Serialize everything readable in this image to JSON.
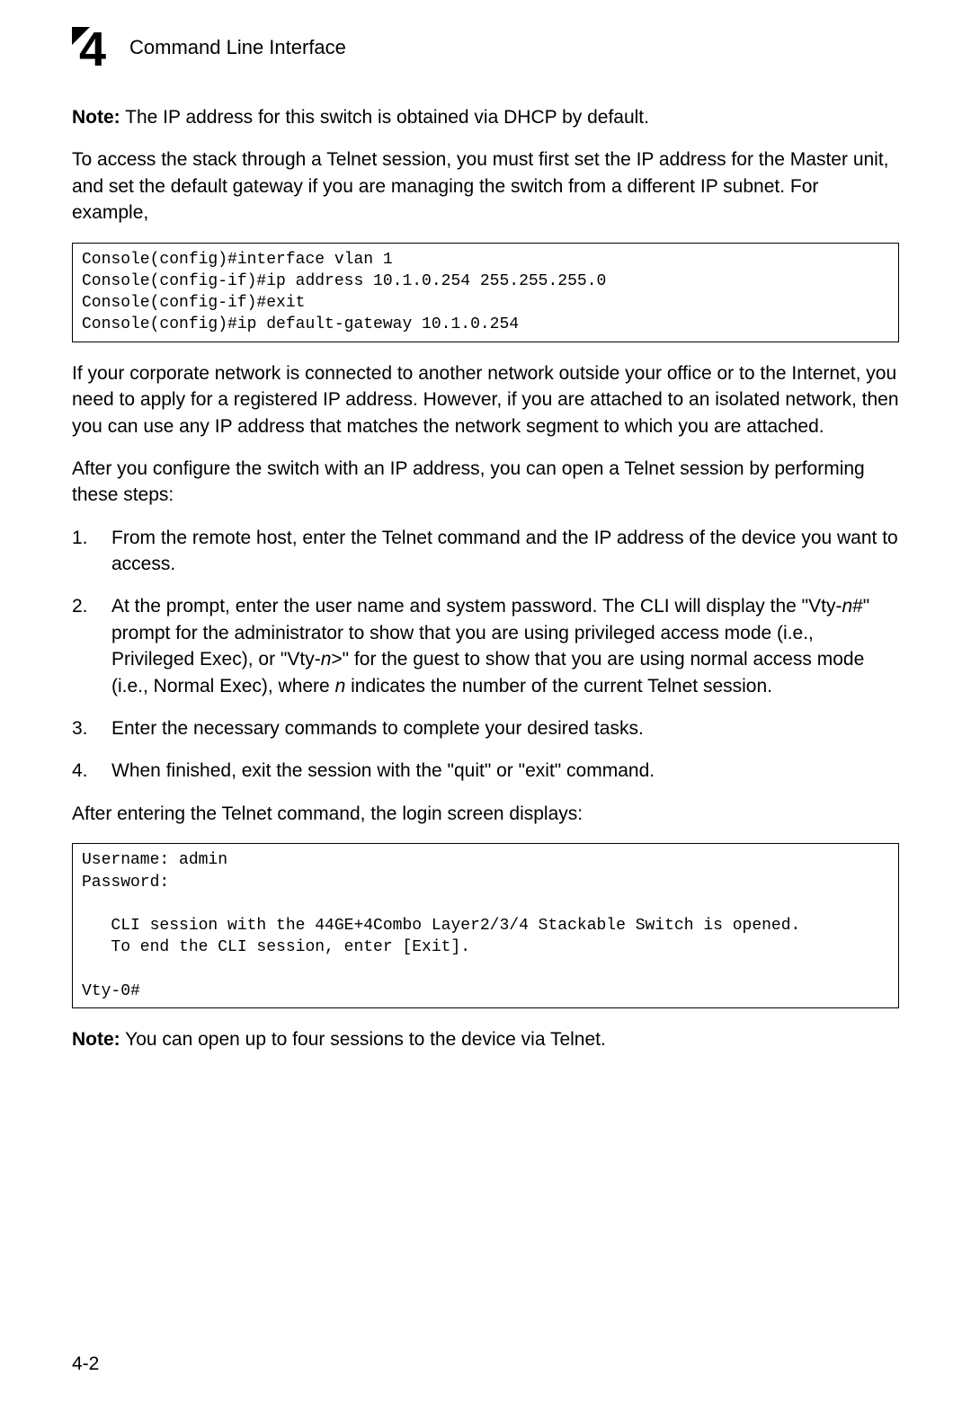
{
  "header": {
    "chapter_number": "4",
    "title": "Command Line Interface"
  },
  "note1_label": "Note:",
  "note1_text": " The IP address for this switch is obtained via DHCP by default.",
  "para1": "To access the stack through a Telnet session, you must first set the IP address for the Master unit, and set the default gateway if you are managing the switch from a different IP subnet. For example,",
  "code_block1": "Console(config)#interface vlan 1\nConsole(config-if)#ip address 10.1.0.254 255.255.255.0\nConsole(config-if)#exit\nConsole(config)#ip default-gateway 10.1.0.254",
  "para2": "If your corporate network is connected to another network outside your office or to the Internet, you need to apply for a registered IP address. However, if you are attached to an isolated network, then you can use any IP address that matches the network segment to which you are attached.",
  "para3": "After you configure the switch with an IP address, you can open a Telnet session by performing these steps:",
  "steps": [
    {
      "num": "1.",
      "parts": [
        {
          "t": "From the remote host, enter the Telnet command and the IP address of the device you want to access.",
          "style": ""
        }
      ]
    },
    {
      "num": "2.",
      "parts": [
        {
          "t": "At the prompt, enter the user name and system password. The CLI will display the \"Vty-",
          "style": ""
        },
        {
          "t": "n",
          "style": "italic"
        },
        {
          "t": "#\" prompt for the administrator to show that you are using privileged access mode (i.e., Privileged Exec), or \"Vty-",
          "style": ""
        },
        {
          "t": "n",
          "style": "italic"
        },
        {
          "t": ">\" for the guest to show that you are using normal access mode (i.e., Normal Exec), where ",
          "style": ""
        },
        {
          "t": "n",
          "style": "italic"
        },
        {
          "t": " indicates the number of the current Telnet session.",
          "style": ""
        }
      ]
    },
    {
      "num": "3.",
      "parts": [
        {
          "t": "Enter the necessary commands to complete your desired tasks.",
          "style": ""
        }
      ]
    },
    {
      "num": "4.",
      "parts": [
        {
          "t": "When finished, exit the session with the \"quit\" or \"exit\" command.",
          "style": ""
        }
      ]
    }
  ],
  "para4": "After entering the Telnet command, the login screen displays:",
  "code_block2": "Username: admin\nPassword:\n\n   CLI session with the 44GE+4Combo Layer2/3/4 Stackable Switch is opened.\n   To end the CLI session, enter [Exit].\n\nVty-0#",
  "note2_label": "Note:",
  "note2_text": " You can open up to four sessions to the device via Telnet.",
  "page_number": "4-2"
}
